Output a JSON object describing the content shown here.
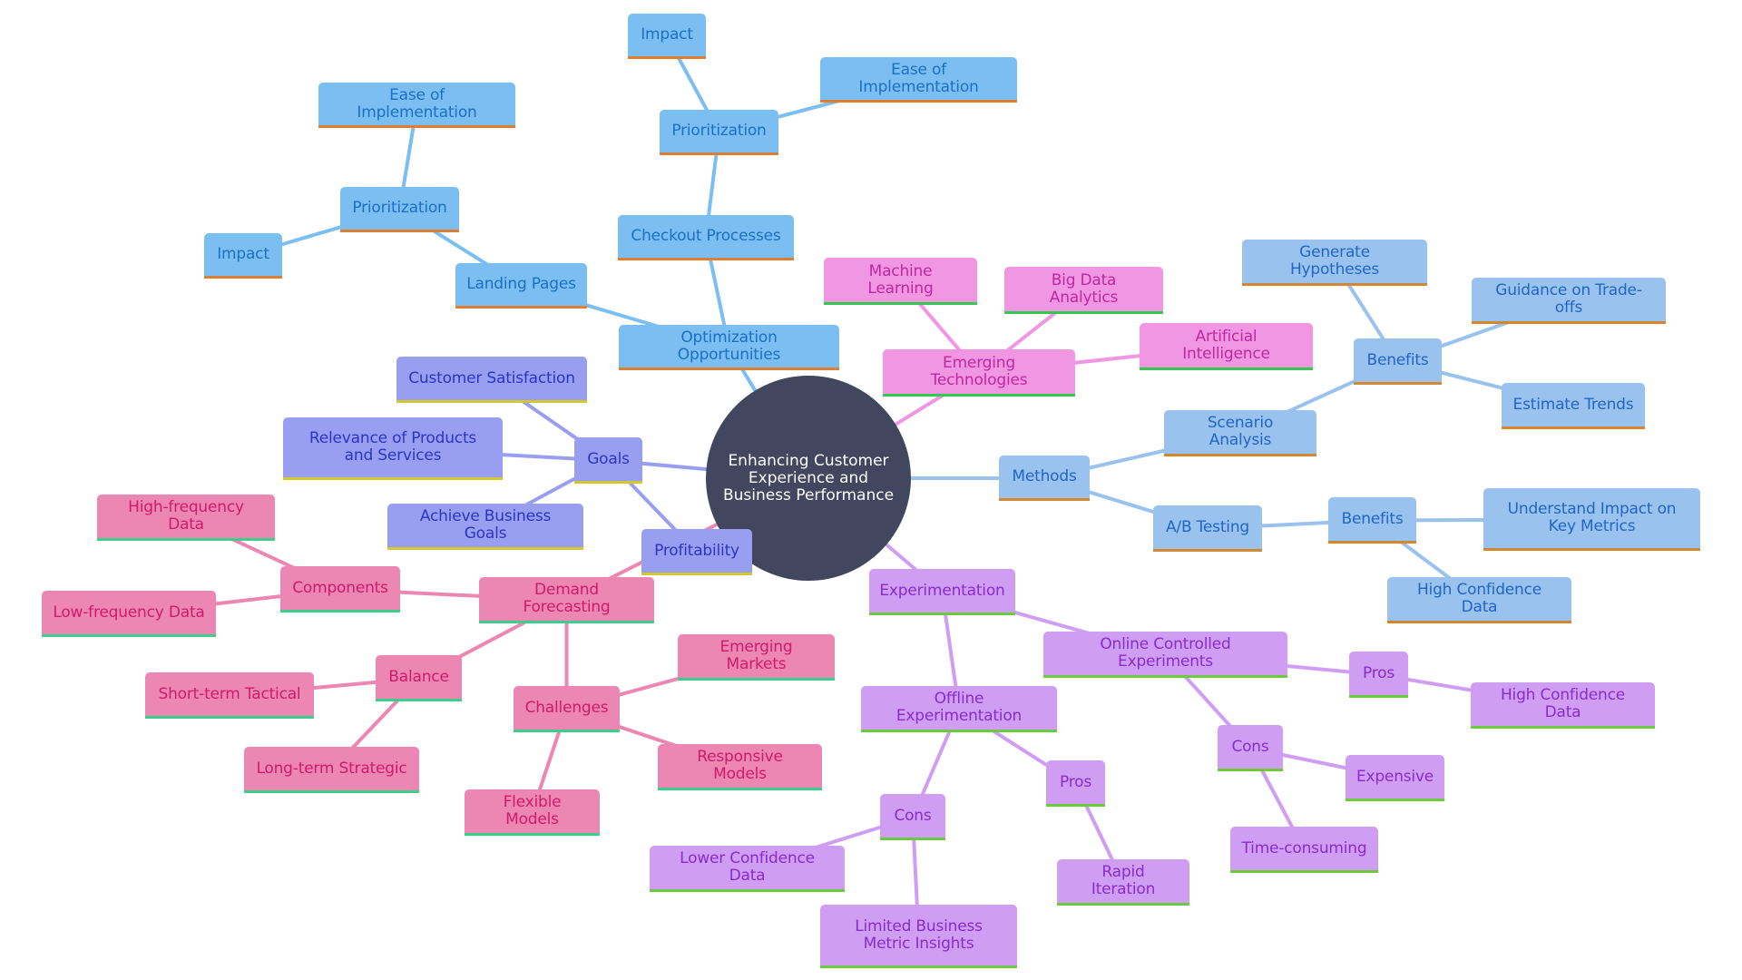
{
  "center": "Enhancing Customer Experience and Business Performance",
  "colors": {
    "optimization_edge": "#7bbff2",
    "methods_edge": "#99c2ee",
    "emerging_edge": "#f196e2",
    "goals_edge": "#999ff0",
    "forecast_edge": "#ec86b3",
    "experiment_edge": "#cf9ef2",
    "center_fill": "#42465e"
  },
  "nodes": {
    "opt": "Optimization Opportunities",
    "landing": "Landing Pages",
    "prio1": "Prioritization",
    "ease1": "Ease of Implementation",
    "impact1": "Impact",
    "checkout": "Checkout Processes",
    "prio2": "Prioritization",
    "impact2": "Impact",
    "ease2": "Ease of Implementation",
    "emerging": "Emerging Technologies",
    "ml": "Machine Learning",
    "bigdata": "Big Data Analytics",
    "ai": "Artificial Intelligence",
    "methods": "Methods",
    "scenario": "Scenario Analysis",
    "benefits1": "Benefits",
    "genhyp": "Generate Hypotheses",
    "guidance": "Guidance on Trade-offs",
    "trends": "Estimate Trends",
    "ab": "A/B Testing",
    "benefits2": "Benefits",
    "understand": "Understand Impact on Key Metrics",
    "hcd1": "High Confidence Data",
    "goals": "Goals",
    "custsat": "Customer Satisfaction",
    "relevance": "Relevance of Products and Services",
    "achieve": "Achieve Business Goals",
    "profit": "Profitability",
    "demand": "Demand Forecasting",
    "components": "Components",
    "hfd": "High-frequency Data",
    "lfd": "Low-frequency Data",
    "balance": "Balance",
    "shortterm": "Short-term Tactical",
    "longterm": "Long-term Strategic",
    "challenges": "Challenges",
    "emmarkets": "Emerging Markets",
    "responsive": "Responsive Models",
    "flexible": "Flexible Models",
    "experimentation": "Experimentation",
    "online": "Online Controlled Experiments",
    "pros1": "Pros",
    "hcd2": "High Confidence Data",
    "cons1": "Cons",
    "expensive": "Expensive",
    "timeconsuming": "Time-consuming",
    "offline": "Offline Experimentation",
    "pros2": "Pros",
    "rapid": "Rapid Iteration",
    "cons2": "Cons",
    "lowerconf": "Lower Confidence Data",
    "limited": "Limited Business Metric Insights"
  }
}
